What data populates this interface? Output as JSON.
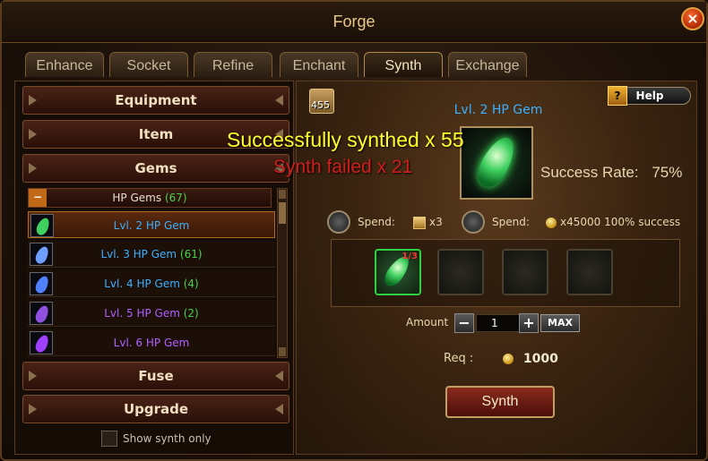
{
  "window": {
    "title": "Forge",
    "close": "×"
  },
  "tabs": [
    {
      "label": "Enhance"
    },
    {
      "label": "Socket"
    },
    {
      "label": "Refine"
    },
    {
      "label": "Enchant"
    },
    {
      "label": "Synth"
    },
    {
      "label": "Exchange"
    }
  ],
  "left": {
    "categories": {
      "equipment": "Equipment",
      "item": "Item",
      "gems": "Gems",
      "fuse": "Fuse",
      "upgrade": "Upgrade"
    },
    "group": {
      "label": "HP Gems",
      "count": "(67)",
      "toggle": "−"
    },
    "gems": [
      {
        "name": "Lvl. 2 HP Gem",
        "count": "",
        "color": "#3ab0ff",
        "gemColor": "#40d060"
      },
      {
        "name": "Lvl. 3 HP Gem",
        "count": "(61)",
        "color": "#3ab0ff",
        "gemColor": "#70a0ff"
      },
      {
        "name": "Lvl. 4 HP Gem",
        "count": "(4)",
        "color": "#3ab0ff",
        "gemColor": "#5080ff"
      },
      {
        "name": "Lvl. 5 HP Gem",
        "count": "(2)",
        "color": "#b060ff",
        "gemColor": "#9050e0"
      },
      {
        "name": "Lvl. 6 HP Gem",
        "count": "",
        "color": "#b060ff",
        "gemColor": "#a040ff"
      }
    ],
    "show_synth_only": "Show synth only"
  },
  "right": {
    "bag_count": "455",
    "help": "Help",
    "help_q": "?",
    "target_name": "Lvl. 2 HP Gem",
    "success_rate_label": "Success Rate:",
    "success_rate_value": "75%",
    "overlay_success": "Successfully synthed x 55",
    "overlay_fail": "Synth failed x 21",
    "spend1_label": "Spend:",
    "spend1_value": "x3",
    "spend2_label": "Spend:",
    "spend2_value": "x45000 100% success",
    "slot_badge": "1/3",
    "amount_label": "Amount",
    "amount_value": "1",
    "amount_minus": "−",
    "amount_plus": "+",
    "max": "MAX",
    "req_label": "Req :",
    "req_value": "1000",
    "synth_button": "Synth"
  },
  "colors": {
    "accent": "#c0a060",
    "success": "#ffff2a",
    "fail": "#d01e1e",
    "gem_name": "#3ab0ff"
  }
}
